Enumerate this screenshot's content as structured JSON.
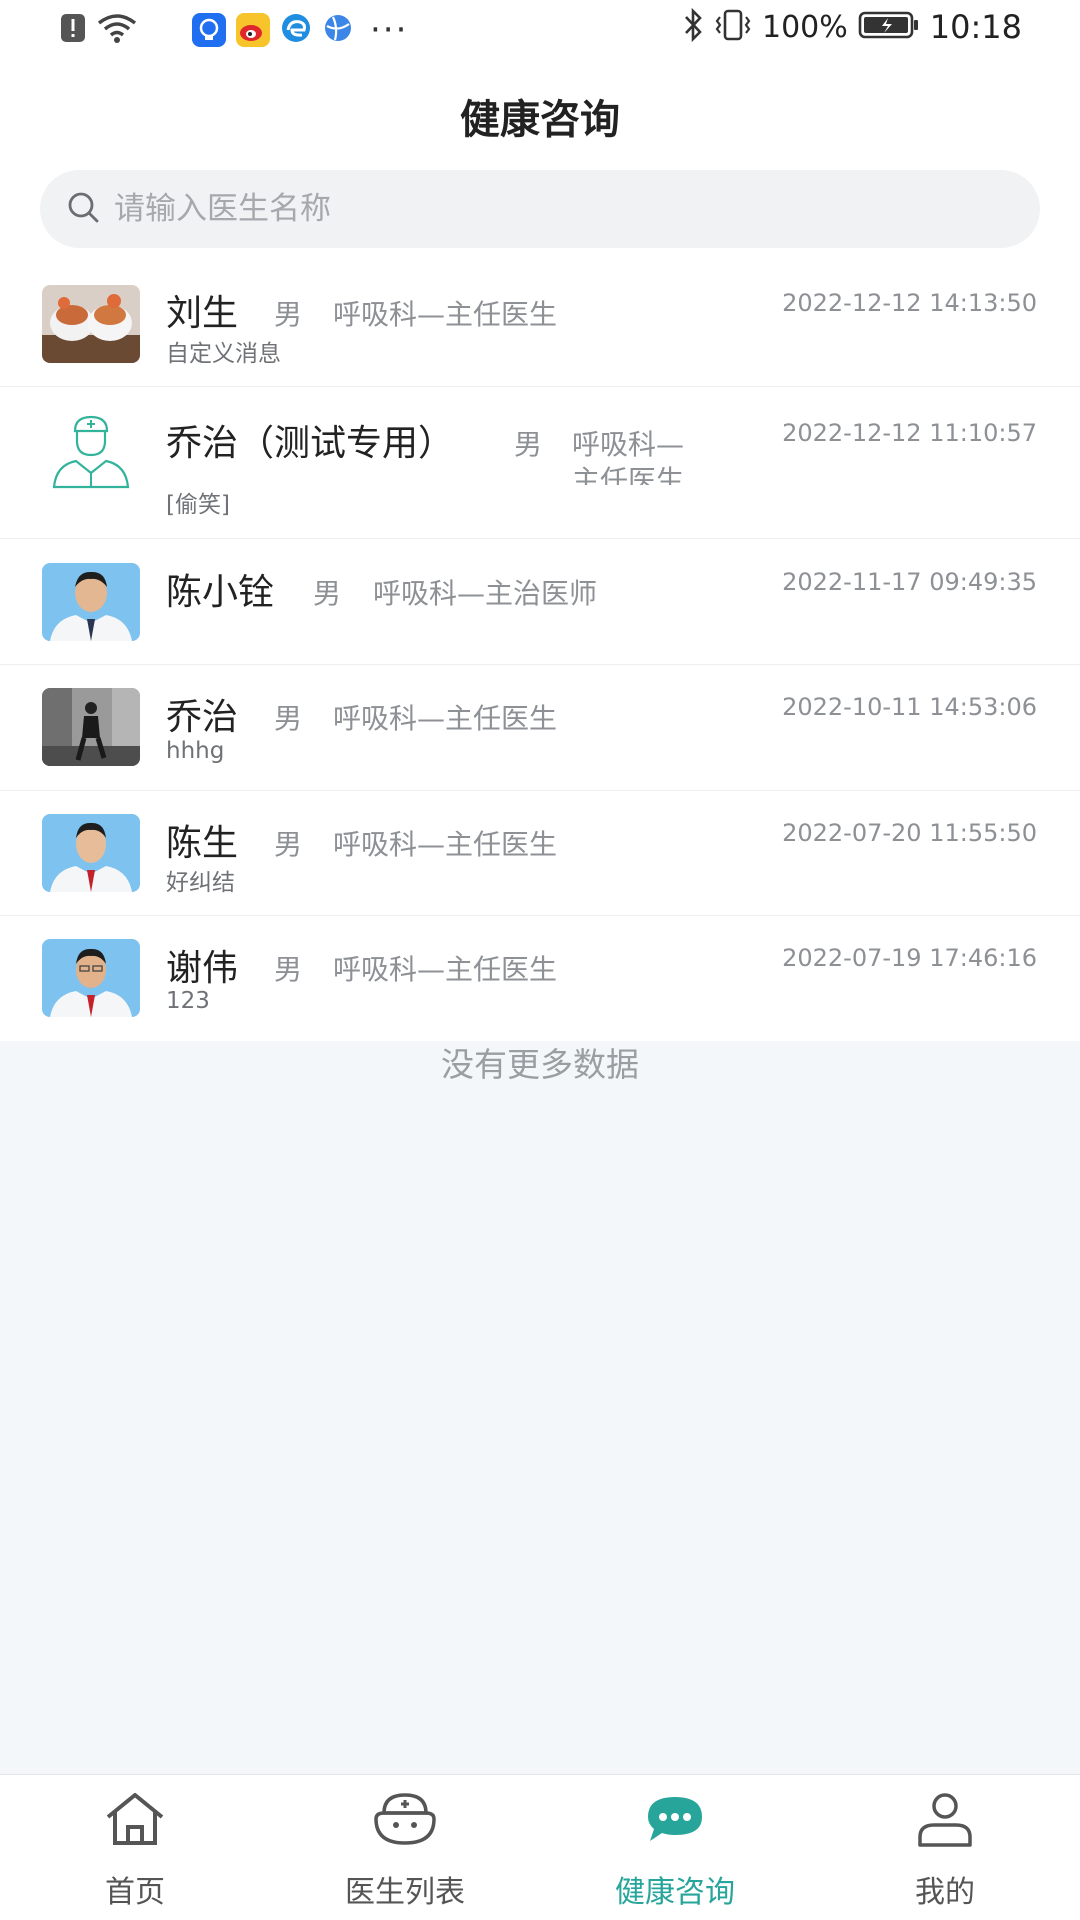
{
  "status_bar": {
    "battery_pct": "100%",
    "time": "10:18",
    "battery_level": 1.0
  },
  "header": {
    "title": "健康咨询"
  },
  "search": {
    "placeholder": "请输入医生名称",
    "value": ""
  },
  "consultations": [
    {
      "name": "刘生",
      "gender": "男",
      "dept": "呼吸科—主任医生",
      "time": "2022-12-12 14:13:50",
      "message": "自定义消息",
      "avatar": "food-photo-avatar"
    },
    {
      "name": "乔治（测试专用）",
      "gender": "男",
      "dept_line1": "呼吸科—",
      "dept_line2": "主任医生",
      "time": "2022-12-12 11:10:57",
      "message": "[偷笑]",
      "avatar": "doctor-outline-avatar"
    },
    {
      "name": "陈小铨",
      "gender": "男",
      "dept": "呼吸科—主治医师",
      "time": "2022-11-17 09:49:35",
      "message": "",
      "avatar": "doctor-photo-avatar"
    },
    {
      "name": "乔治",
      "gender": "男",
      "dept": "呼吸科—主任医生",
      "time": "2022-10-11 14:53:06",
      "message": "hhhg",
      "avatar": "street-photo-avatar"
    },
    {
      "name": "陈生",
      "gender": "男",
      "dept": "呼吸科—主任医生",
      "time": "2022-07-20 11:55:50",
      "message": "好纠结",
      "avatar": "doctor-photo-avatar"
    },
    {
      "name": "谢伟",
      "gender": "男",
      "dept": "呼吸科—主任医生",
      "time": "2022-07-19 17:46:16",
      "message": "123",
      "avatar": "doctor-photo-avatar"
    }
  ],
  "list_footer": "没有更多数据",
  "tabbar": {
    "tabs": [
      {
        "label": "首页",
        "icon": "home-icon",
        "active": false
      },
      {
        "label": "医生列表",
        "icon": "doctor-icon",
        "active": false
      },
      {
        "label": "健康咨询",
        "icon": "chat-icon",
        "active": true
      },
      {
        "label": "我的",
        "icon": "user-icon",
        "active": false
      }
    ]
  },
  "colors": {
    "accent": "#27a59a",
    "background": "#f3f7fa",
    "secondary_text": "#8d9094"
  }
}
